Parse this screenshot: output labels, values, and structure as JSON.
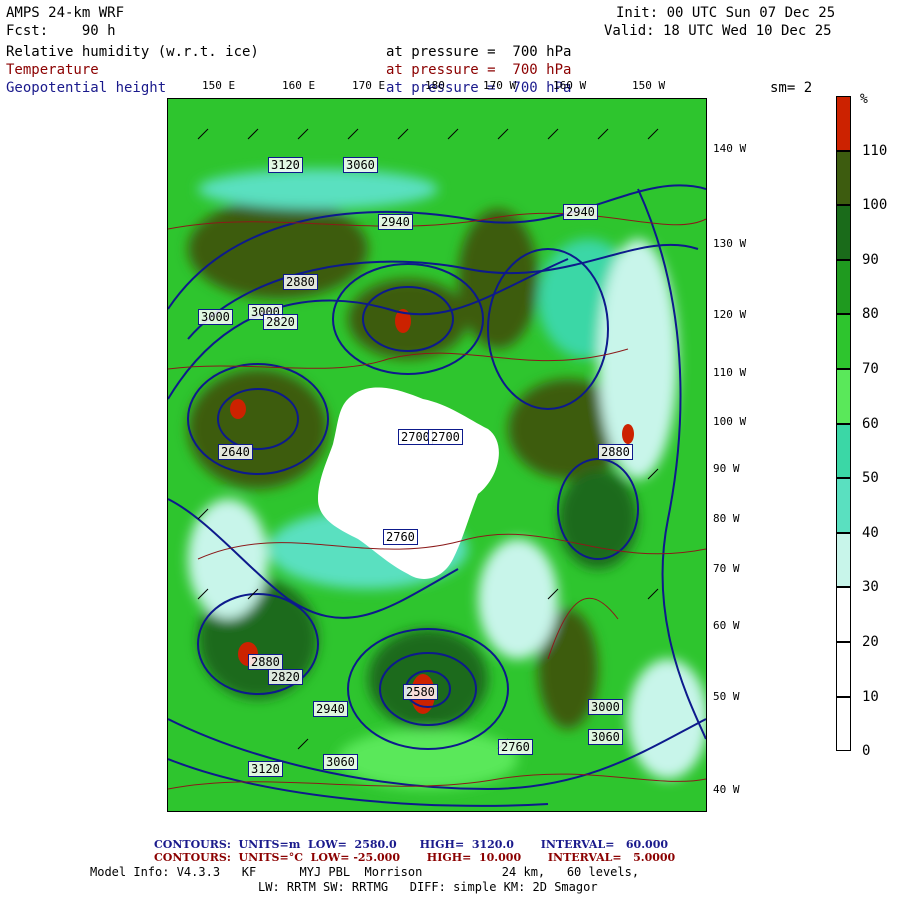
{
  "header": {
    "model": "AMPS 24-km WRF",
    "fcst": "Fcst:    90 h",
    "init": "Init: 00 UTC Sun 07 Dec 25",
    "valid": "Valid: 18 UTC Wed 10 Dec 25",
    "field1_name": "Relative humidity (w.r.t. ice)",
    "field1_level": "at pressure =  700 hPa",
    "field2_name": "Temperature",
    "field2_level": "at pressure =  700 hPa",
    "field3_name": "Geopotential height",
    "field3_level": "at pressure =  700 hPa",
    "smoothing": "sm= 2"
  },
  "map": {
    "lon_labels": [
      "150 E",
      "160 E",
      "170 E",
      "180",
      "170 W",
      "160 W",
      "150 W"
    ],
    "lat_labels": [
      "140 W",
      "130 W",
      "120 W",
      "110 W",
      "100 W",
      "90 W",
      "80 W",
      "70 W",
      "60 W",
      "50 W",
      "40 W"
    ],
    "height_contour_labels": [
      "3120",
      "3060",
      "3000",
      "2940",
      "2880",
      "2820",
      "2760",
      "2700",
      "2640",
      "2580",
      "3000",
      "2940",
      "2880",
      "2820",
      "2760",
      "2700",
      "3060",
      "3120",
      "2940",
      "3000",
      "2880",
      "3060"
    ]
  },
  "colorbar": {
    "unit": "%",
    "ticks": [
      "110",
      "100",
      "90",
      "80",
      "70",
      "60",
      "50",
      "40",
      "30",
      "20",
      "10",
      "0"
    ],
    "colors": [
      "#cc2200",
      "#3d5c0f",
      "#1a6b1a",
      "#1f9a1f",
      "#2ec52e",
      "#5ae85a",
      "#3bd7a6",
      "#5ae0c0",
      "#c8f5ea",
      "#ffffff",
      "#ffffff",
      "#ffffff"
    ]
  },
  "footer": {
    "line1_label": "CONTOURS:  UNITS=m  LOW=  2580.0      HIGH=  3120.0       INTERVAL=   60.000",
    "line2_label": "CONTOURS:  UNITS=°C  LOW= -25.000       HIGH=  10.000       INTERVAL=   5.0000",
    "line3": "Model Info: V4.3.3   KF      MYJ PBL  Morrison           24 km,   60 levels,",
    "line4": "LW: RRTM SW: RRTMG   DIFF: simple KM: 2D Smagor"
  }
}
